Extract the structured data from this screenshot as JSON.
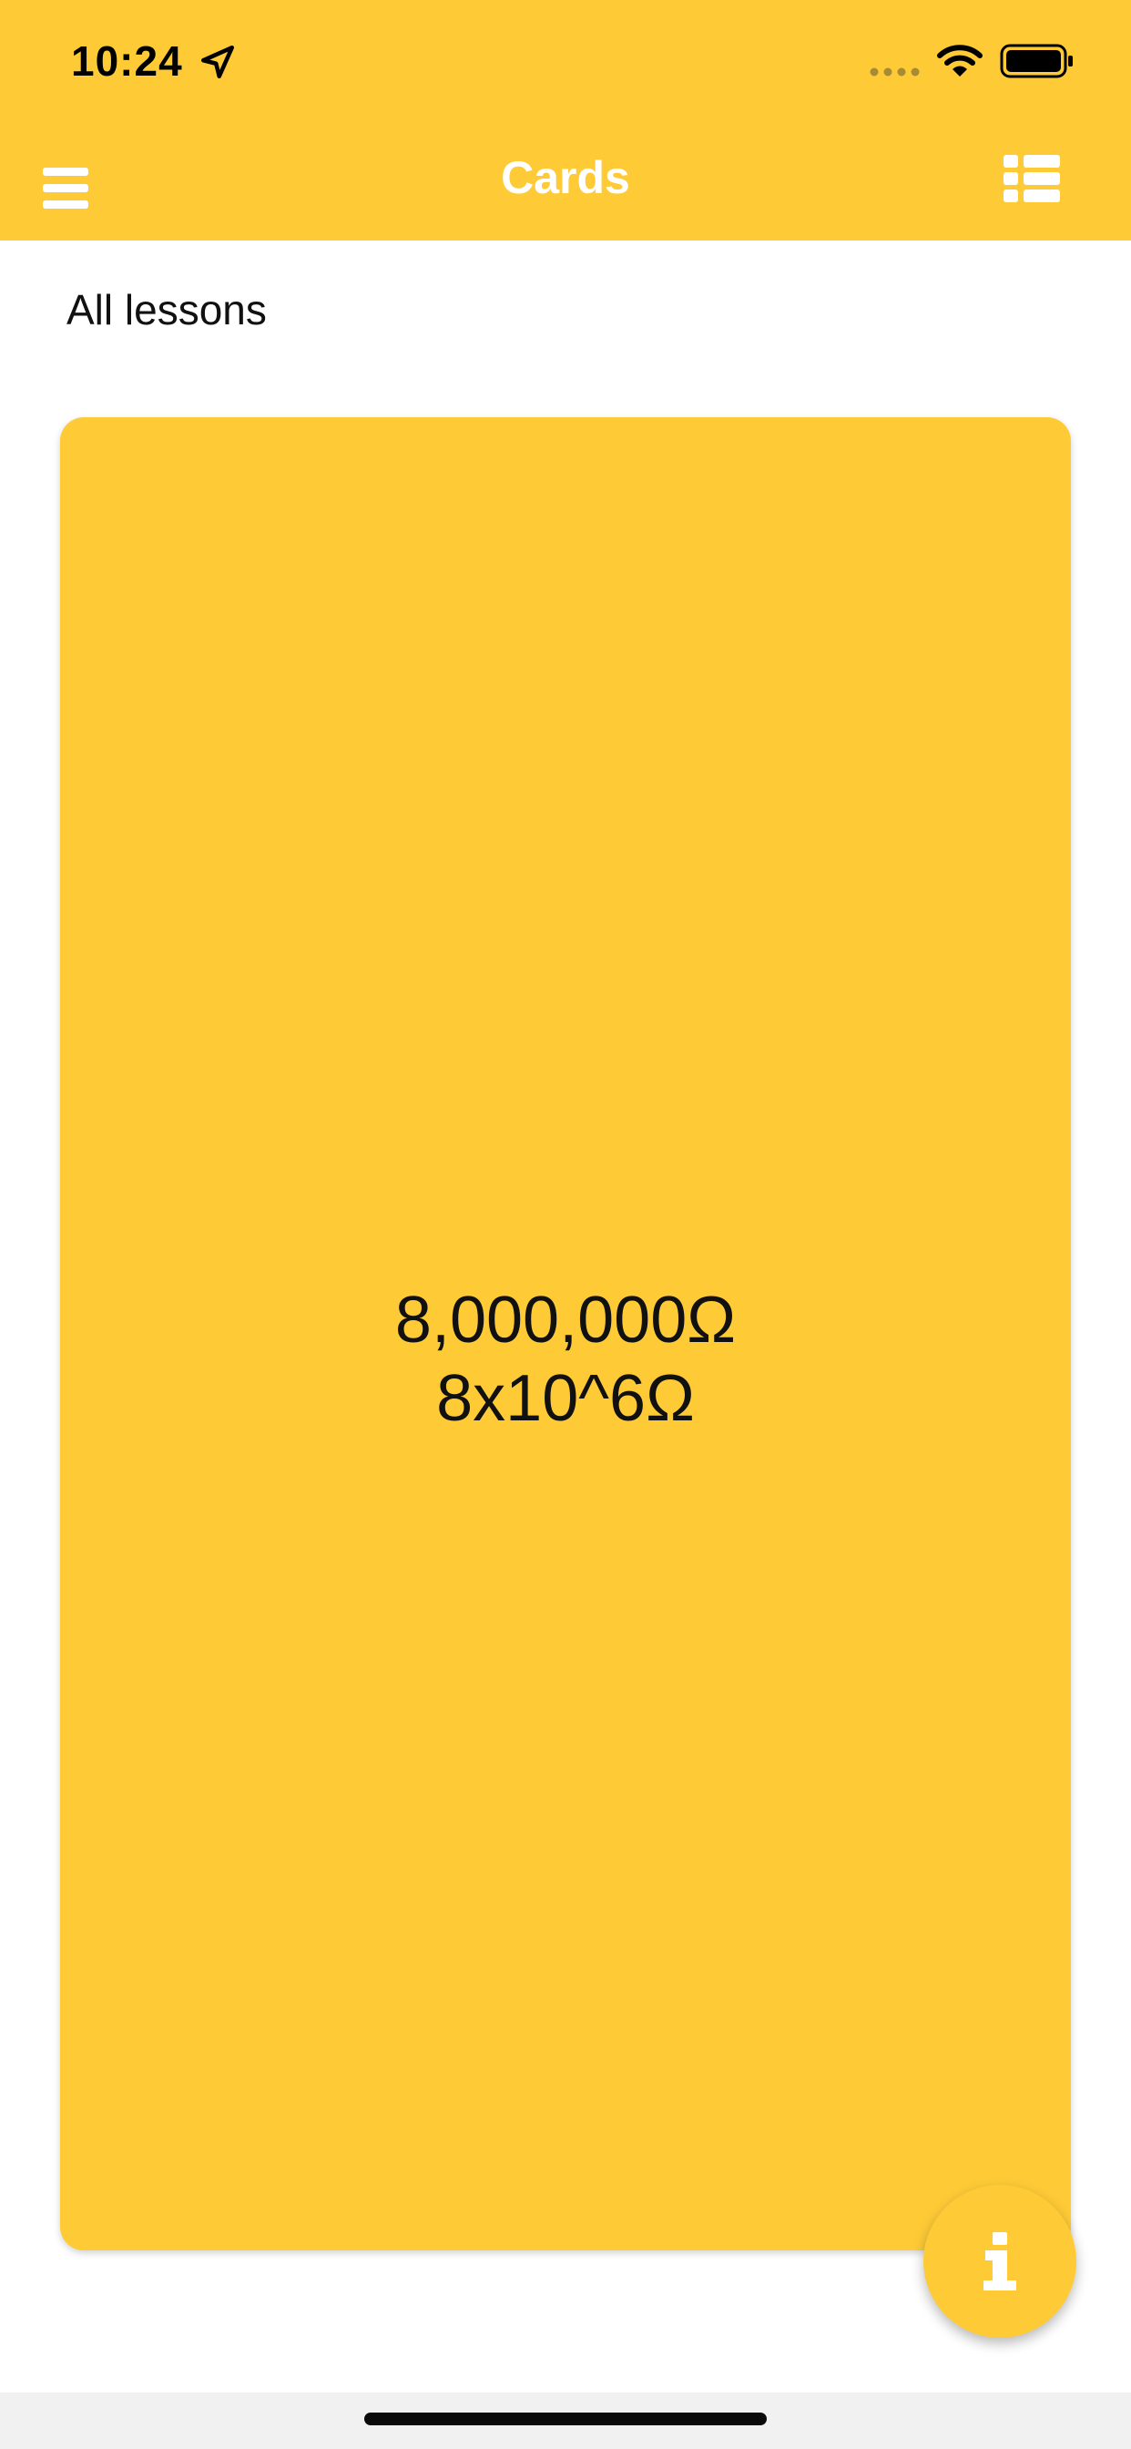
{
  "status_bar": {
    "time": "10:24"
  },
  "header": {
    "title": "Cards",
    "background_color": "#FECB37",
    "title_color": "#FFFFFF"
  },
  "lesson_filter": {
    "label": "All lessons"
  },
  "card": {
    "line1": "8,000,000Ω",
    "line2": "8x10^6Ω",
    "background_color": "#FECB37"
  },
  "icons": {
    "menu": "hamburger-menu-icon",
    "list": "list-view-icon",
    "info": "info-icon",
    "location": "location-arrow-icon",
    "wifi": "wifi-icon",
    "battery": "battery-icon",
    "signal": "cellular-signal-icon"
  }
}
